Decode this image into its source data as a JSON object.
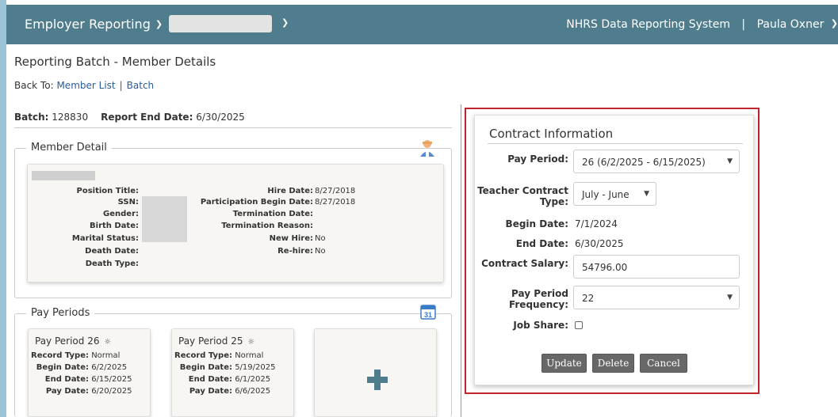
{
  "topbar": {
    "menu_label": "Employer Reporting",
    "system_name": "NHRS Data Reporting System",
    "separator": "|",
    "user_name": "Paula Oxner"
  },
  "page": {
    "title": "Reporting Batch - Member Details",
    "back_to_label": "Back To:",
    "back_links": [
      "Member List",
      "Batch"
    ],
    "back_separator": "|"
  },
  "batch": {
    "batch_label": "Batch:",
    "batch_number": "128830",
    "report_end_label": "Report End Date:",
    "report_end_date": "6/30/2025"
  },
  "member_detail": {
    "legend": "Member Detail",
    "left_labels": [
      "Position Title:",
      "SSN:",
      "Gender:",
      "Birth Date:",
      "Marital Status:",
      "Death Date:",
      "Death Type:"
    ],
    "right_labels": [
      "Hire Date:",
      "Participation Begin Date:",
      "Termination Date:",
      "Termination Reason:",
      "New Hire:",
      "Re-hire:"
    ],
    "right_values": [
      "8/27/2018",
      "8/27/2018",
      "",
      "",
      "No",
      "No"
    ]
  },
  "pay_periods": {
    "legend": "Pay Periods",
    "row_labels": [
      "Record Type:",
      "Begin Date:",
      "End Date:",
      "Pay Date:"
    ],
    "cards": [
      {
        "title": "Pay Period 26",
        "record_type": "Normal",
        "begin_date": "6/2/2025",
        "end_date": "6/15/2025",
        "pay_date": "6/20/2025"
      },
      {
        "title": "Pay Period 25",
        "record_type": "Normal",
        "begin_date": "5/19/2025",
        "end_date": "6/1/2025",
        "pay_date": "6/6/2025"
      }
    ]
  },
  "contract": {
    "title": "Contract Information",
    "pay_period_label": "Pay Period:",
    "pay_period_value": "26 (6/2/2025 - 6/15/2025)",
    "teacher_contract_label_1": "Teacher Contract",
    "teacher_contract_label_2": "Type:",
    "teacher_contract_value": "July - June",
    "begin_date_label": "Begin Date:",
    "begin_date_value": "7/1/2024",
    "end_date_label": "End Date:",
    "end_date_value": "6/30/2025",
    "salary_label": "Contract Salary:",
    "salary_value": "54796.00",
    "frequency_label_1": "Pay Period",
    "frequency_label_2": "Frequency:",
    "frequency_value": "22",
    "job_share_label": "Job Share:",
    "job_share_checked": false,
    "buttons": {
      "update": "Update",
      "delete": "Delete",
      "cancel": "Cancel"
    }
  },
  "colors": {
    "header": "#4f7d8e",
    "button": "#686868",
    "highlight_border": "#c0242b",
    "background": "#9bc4d6"
  }
}
